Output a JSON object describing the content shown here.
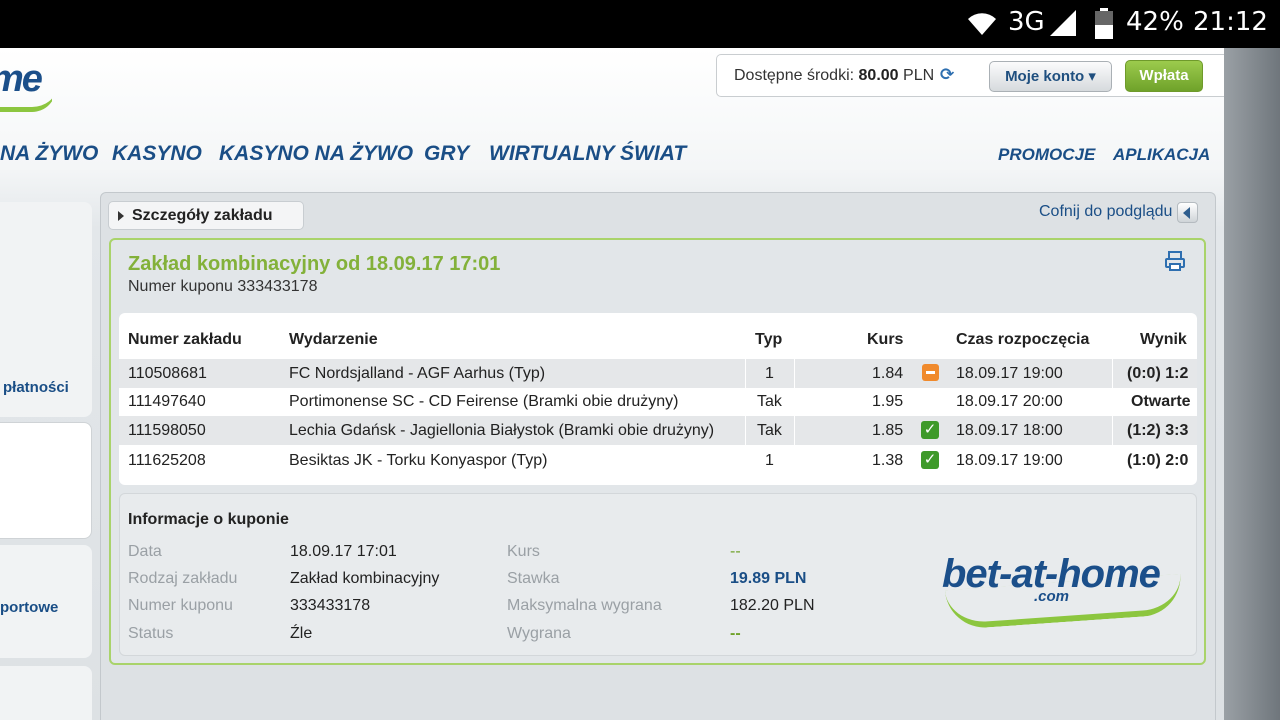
{
  "statusbar": {
    "network": "3G",
    "battery": "42%",
    "time": "21:12"
  },
  "header": {
    "logo_text": "me",
    "funds_label": "Dostępne środki:",
    "funds_value": "80.00",
    "funds_currency": "PLN",
    "account_button": "Moje konto ▾",
    "deposit_button": "Wpłata"
  },
  "nav": {
    "items": [
      "NA ŻYWO",
      "KASYNO",
      "KASYNO NA ŻYWO",
      "GRY",
      "WIRTUALNY ŚWIAT"
    ],
    "right_items": [
      "PROMOCJE",
      "APLIKACJA"
    ]
  },
  "sidebar": {
    "label_1": "płatności",
    "label_2": "portowe"
  },
  "breadcrumb": {
    "label": "Szczegóły zakładu",
    "back_link": "Cofnij do podglądu"
  },
  "bet": {
    "title": "Zakład kombinacyjny od 18.09.17 17:01",
    "subtitle": "Numer kuponu 333433178",
    "columns": [
      "Numer zakładu",
      "Wydarzenie",
      "Typ",
      "Kurs",
      "Czas rozpoczęcia",
      "Wynik"
    ],
    "rows": [
      {
        "id": "110508681",
        "event": "FC Nordsjalland - AGF Aarhus (Typ)",
        "type": "1",
        "odds": "1.84",
        "status": "lost",
        "start": "18.09.17 19:00",
        "result": "(0:0) 1:2"
      },
      {
        "id": "111497640",
        "event": "Portimonense SC - CD Feirense (Bramki obie drużyny)",
        "type": "Tak",
        "odds": "1.95",
        "status": "none",
        "start": "18.09.17 20:00",
        "result": "Otwarte"
      },
      {
        "id": "111598050",
        "event": "Lechia Gdańsk - Jagiellonia Białystok (Bramki obie drużyny)",
        "type": "Tak",
        "odds": "1.85",
        "status": "won",
        "start": "18.09.17 18:00",
        "result": "(1:2) 3:3"
      },
      {
        "id": "111625208",
        "event": "Besiktas JK - Torku Konyaspor (Typ)",
        "type": "1",
        "odds": "1.38",
        "status": "won",
        "start": "18.09.17 19:00",
        "result": "(1:0) 2:0"
      }
    ]
  },
  "coupon_info": {
    "title": "Informacje o kuponie",
    "left": [
      {
        "label": "Data",
        "value": "18.09.17 17:01"
      },
      {
        "label": "Rodzaj zakładu",
        "value": "Zakład kombinacyjny"
      },
      {
        "label": "Numer kuponu",
        "value": "333433178"
      },
      {
        "label": "Status",
        "value": "Źle"
      }
    ],
    "right": [
      {
        "label": "Kurs",
        "value": "--"
      },
      {
        "label": "Stawka",
        "value": "19.89 PLN"
      },
      {
        "label": "Maksymalna wygrana",
        "value": "182.20 PLN"
      },
      {
        "label": "Wygrana",
        "value": "--"
      }
    ],
    "brand_logo": "bet-at-home",
    "brand_logo_sub": ".com"
  },
  "colors": {
    "accent_green": "#83b13a",
    "link_blue": "#1a4e86",
    "lost_orange": "#f08a2c",
    "won_green": "#3e9a2a"
  }
}
